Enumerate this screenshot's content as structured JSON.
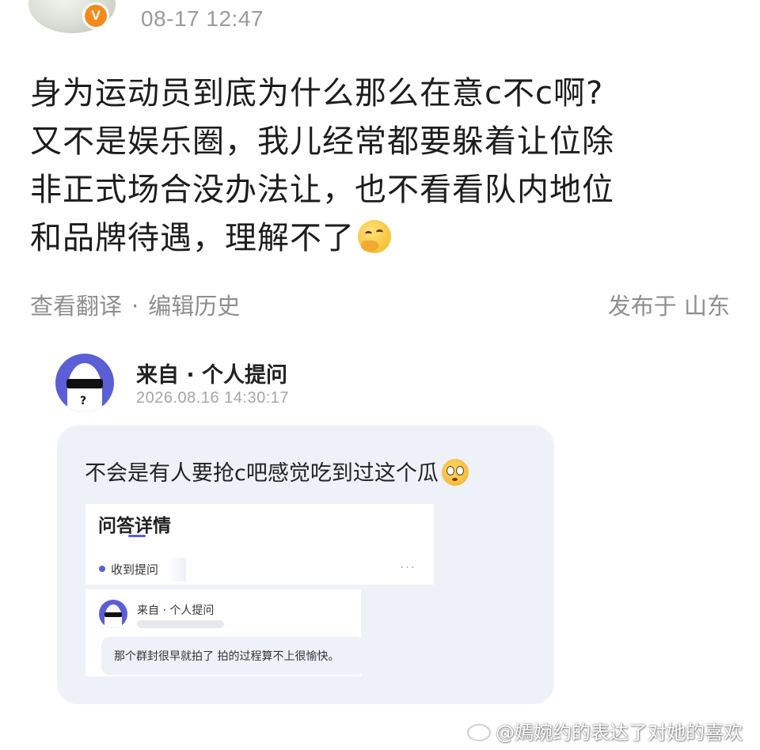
{
  "header": {
    "timestamp": "08-17 12:47",
    "verified_badge": "V"
  },
  "post": {
    "lines": [
      "身为运动员到底为什么那么在意c不c啊?",
      "又不是娱乐圈，我儿经常都要躲着让位除",
      "非正式场合没办法让，也不看看队内地位",
      "和品牌待遇，理解不了"
    ],
    "emoji": "thinking-face-icon"
  },
  "meta": {
    "translate": "查看翻译",
    "separator": "·",
    "edit_history": "编辑历史",
    "location": "发布于 山东"
  },
  "question": {
    "from": "来自 · 个人提问",
    "date": "2026.08.16 14:30:17",
    "text": "不会是有人要抢c吧感觉吃到过这个瓜",
    "emoji": "flushed-face-icon"
  },
  "inner_screenshot": {
    "title": "问答详情",
    "received": "收到提问",
    "more": "···",
    "from": "来自 · 个人提问",
    "answer": "那个群封很早就拍了 拍的过程算不上很愉快。"
  },
  "watermark": "@嫣婉约的表达了对她的喜欢",
  "colors": {
    "accent": "#5b5fd6",
    "verified": "#f28b1c",
    "meta_text": "#8e8e8e",
    "card_bg": "#eff1f8"
  }
}
